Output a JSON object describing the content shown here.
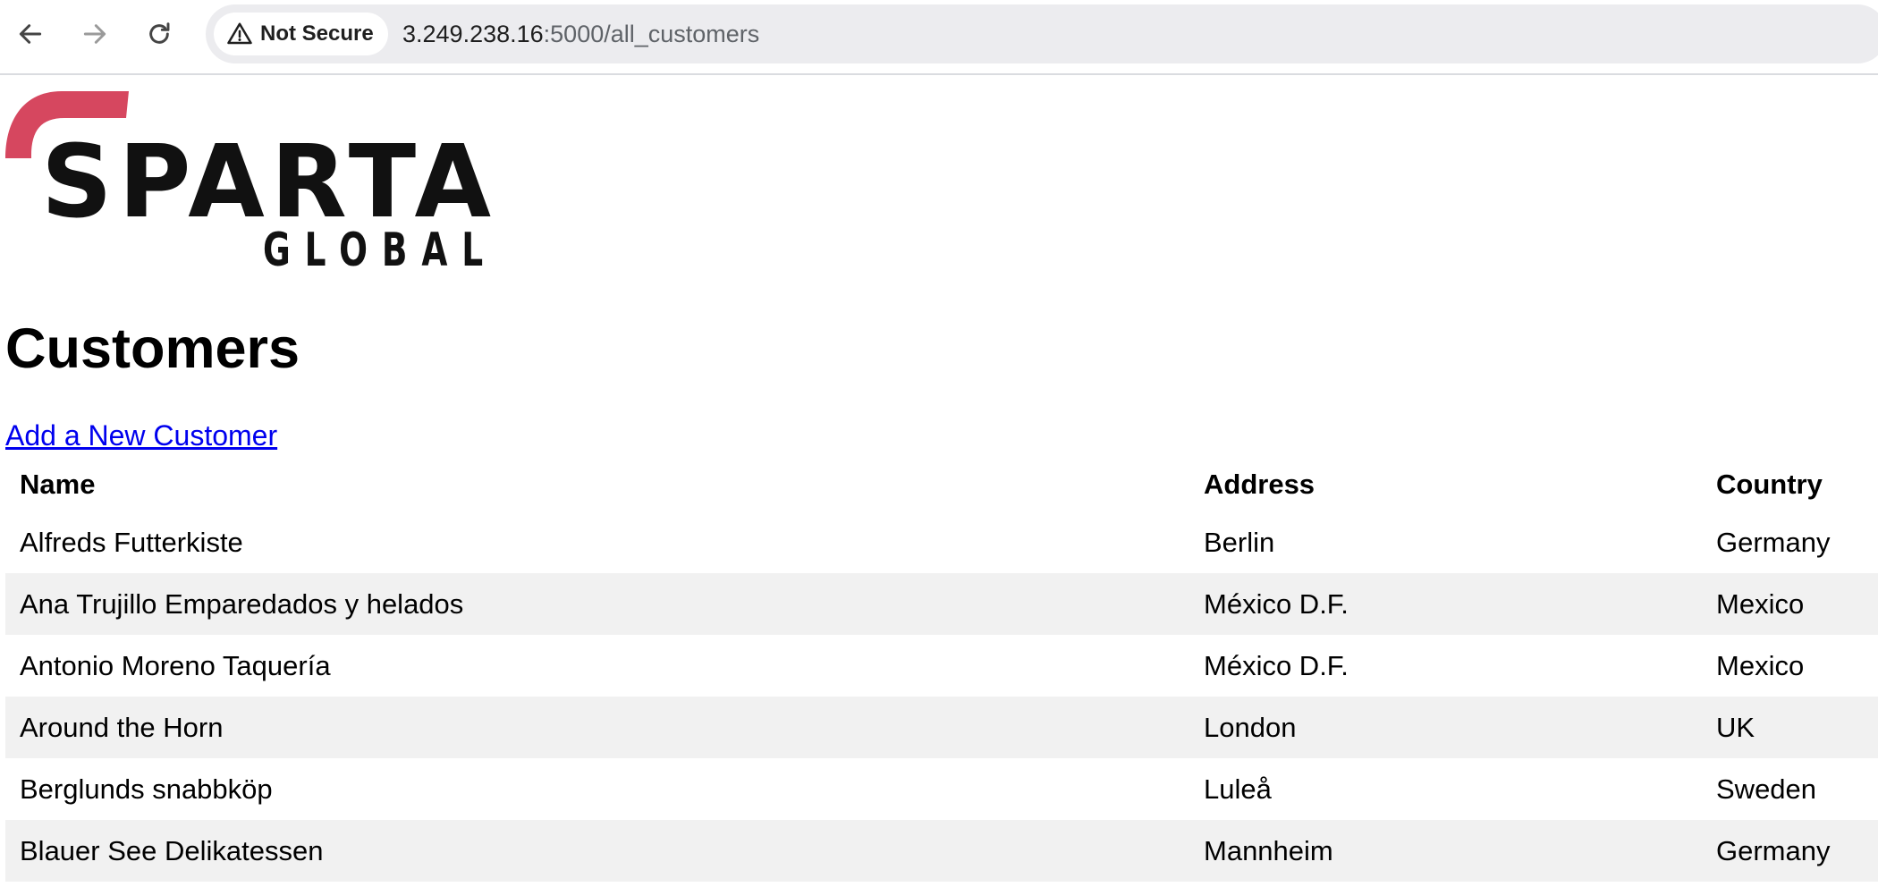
{
  "browser": {
    "nav": {
      "back_icon": "arrow-left-icon",
      "forward_icon": "arrow-right-icon",
      "reload_icon": "reload-icon"
    },
    "security": {
      "icon": "warning-triangle-icon",
      "label": "Not Secure"
    },
    "url": {
      "host": "3.249.238.16",
      "rest": ":5000/all_customers"
    }
  },
  "logo": {
    "top_word": "SPARTA",
    "bottom_word": "GLOBAL",
    "accent_color": "#d6475f"
  },
  "page": {
    "title": "Customers",
    "add_link": "Add a New Customer"
  },
  "table": {
    "headers": [
      "Name",
      "Address",
      "Country"
    ],
    "rows": [
      [
        "Alfreds Futterkiste",
        "Berlin",
        "Germany"
      ],
      [
        "Ana Trujillo Emparedados y helados",
        "México D.F.",
        "Mexico"
      ],
      [
        "Antonio Moreno Taquería",
        "México D.F.",
        "Mexico"
      ],
      [
        "Around the Horn",
        "London",
        "UK"
      ],
      [
        "Berglunds snabbköp",
        "Luleå",
        "Sweden"
      ],
      [
        "Blauer See Delikatessen",
        "Mannheim",
        "Germany"
      ]
    ]
  },
  "colors": {
    "link": "#0000ee",
    "stripe": "#f1f1f1",
    "omnibox": "#ececef"
  }
}
